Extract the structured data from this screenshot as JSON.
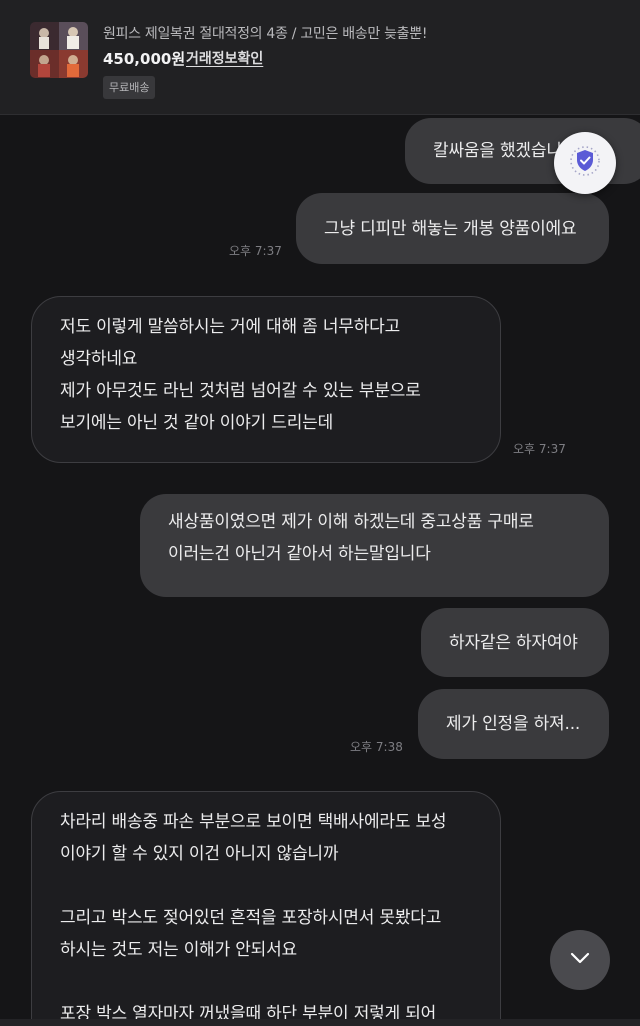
{
  "product": {
    "title": "원피스 제일복권 절대적정의 4종 / 고민은 배송만 늦출뿐!",
    "price": "450,000원",
    "trade_info_link": "거래정보확인",
    "shipping_badge": "무료배송"
  },
  "messages": [
    {
      "from": "me",
      "lines": [
        "칼싸움을 했겠습니다"
      ]
    },
    {
      "from": "me",
      "lines": [
        "그냥 디피만 해놓는 개봉 양품이에요"
      ],
      "time": "오후 7:37"
    },
    {
      "from": "them",
      "lines": [
        "저도 이렇게 말씀하시는 거에 대해 좀 너무하다고",
        "생각하네요",
        "제가 아무것도 라닌 것처럼 넘어갈 수 있는 부분으로",
        "보기에는 아닌 것 같아 이야기 드리는데"
      ],
      "time": "오후 7:37"
    },
    {
      "from": "me",
      "lines": [
        "새상품이였으면 제가 이해 하겠는데 중고상품 구매로",
        "이러는건 아닌거 같아서 하는말입니다"
      ]
    },
    {
      "from": "me",
      "lines": [
        "하자같은 하자여야"
      ]
    },
    {
      "from": "me",
      "lines": [
        "제가 인정을 하져..."
      ],
      "time": "오후 7:38"
    },
    {
      "from": "them",
      "lines": [
        "차라리 배송중 파손 부분으로 보이면 택배사에라도 보성",
        "이야기 할 수 있지 이건 아니지 않습니까",
        "",
        "그리고 박스도 젖어있던 흔적을 포장하시면서 못봤다고",
        "하시는 것도 저는 이해가 안되서요",
        "",
        "포장 박스 열자마자 꺼냈을때 하단 부분이 저렇게 되어"
      ]
    }
  ],
  "icons": {
    "shield": "shield-check-icon",
    "scroll": "chevron-down-icon"
  },
  "colors": {
    "background": "#151517",
    "my_bubble": "#3a3a3d",
    "their_bubble": "#1d1d20",
    "shield_accent": "#5b5bd6"
  }
}
